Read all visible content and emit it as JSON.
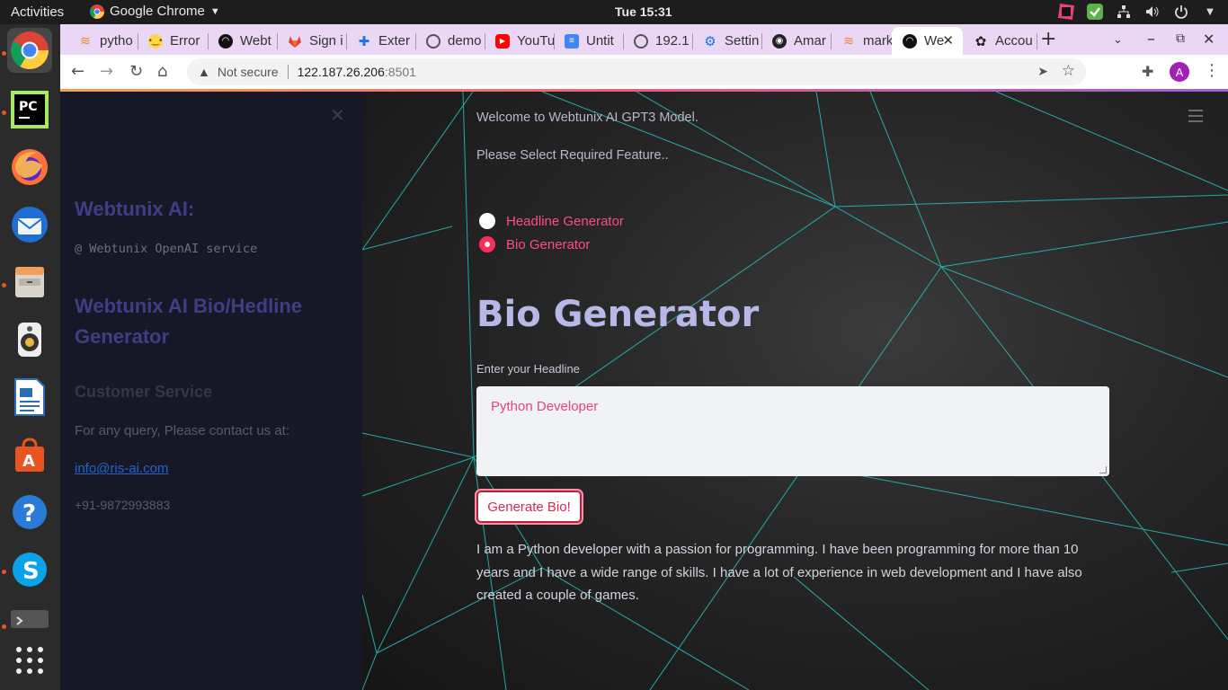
{
  "system_bar": {
    "activities": "Activities",
    "app_name": "Google Chrome",
    "clock": "Tue 15:31"
  },
  "browser": {
    "tabs": [
      {
        "label": "pytho",
        "icon": "stackoverflow-icon"
      },
      {
        "label": "Error",
        "icon": "emoji-icon"
      },
      {
        "label": "Webt",
        "icon": "streamlit-icon"
      },
      {
        "label": "Sign i",
        "icon": "gitlab-icon"
      },
      {
        "label": "Exter",
        "icon": "puzzle-icon"
      },
      {
        "label": "demo",
        "icon": "globe-icon"
      },
      {
        "label": "YouTu",
        "icon": "youtube-icon"
      },
      {
        "label": "Untit",
        "icon": "docs-icon"
      },
      {
        "label": "192.1",
        "icon": "globe-icon"
      },
      {
        "label": "Settin",
        "icon": "gear-icon"
      },
      {
        "label": "Amar",
        "icon": "github-icon"
      },
      {
        "label": "mark",
        "icon": "stackoverflow-icon"
      },
      {
        "label": "We",
        "icon": "streamlit-icon",
        "active": true
      },
      {
        "label": "Accou",
        "icon": "openai-icon"
      }
    ],
    "address": {
      "security_label": "Not secure",
      "host": "122.187.26.206",
      "port": ":8501"
    },
    "profile_initial": "A"
  },
  "sidebar": {
    "title": "Webtunix AI:",
    "subtitle": "@ Webtunix OpenAI service",
    "heading": "Webtunix AI Bio/Hedline Generator",
    "section_title": "Customer Service",
    "contact_text": "For any query, Please contact us at:",
    "email": "info@ris-ai.com",
    "phone": "+91-9872993883"
  },
  "main": {
    "welcome": "Welcome to Webtunix AI GPT3 Model.",
    "prompt": "Please Select Required Feature..",
    "options": [
      {
        "label": "Headline Generator",
        "selected": false
      },
      {
        "label": "Bio Generator",
        "selected": true
      }
    ],
    "heading": "Bio Generator",
    "input_label": "Enter your Headline",
    "input_value": "Python Developer",
    "button_label": "Generate Bio!",
    "output": "I am a Python developer with a passion for programming. I have been programming for more than 10 years and I have a wide range of skills. I have a lot of experience in web development and I have also created a couple of games."
  },
  "colors": {
    "accent": "#ff2b58",
    "sidebar_bg": "#161828",
    "tabstrip_bg": "#ead6f5",
    "link": "#2563c9"
  }
}
